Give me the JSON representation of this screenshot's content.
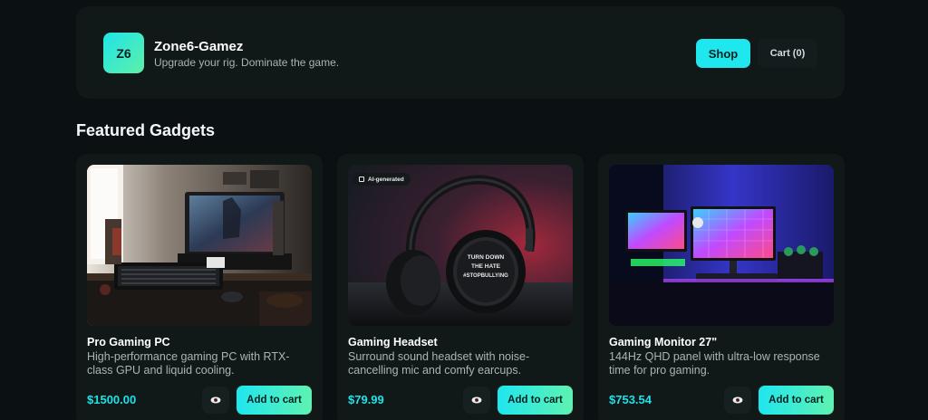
{
  "header": {
    "logo_text": "Z6",
    "brand_name": "Zone6-Gamez",
    "tagline": "Upgrade your rig. Dominate the game.",
    "shop_label": "Shop",
    "cart_label": "Cart (0)"
  },
  "section_title": "Featured Gadgets",
  "products": [
    {
      "title": "Pro Gaming PC",
      "description": "High-performance gaming PC with RTX-class GPU and liquid cooling.",
      "price": "$1500.00",
      "add_label": "Add to cart",
      "view_icon": "eye-icon"
    },
    {
      "title": "Gaming Headset",
      "description": "Surround sound headset with noise-cancelling mic and comfy earcups.",
      "price": "$79.99",
      "add_label": "Add to cart",
      "view_icon": "eye-icon",
      "badge": "AI-generated",
      "image_text": "TURN DOWN THE HATE #STOPBULLYING"
    },
    {
      "title": "Gaming Monitor 27\"",
      "description": "144Hz QHD panel with ultra-low response time for pro gaming.",
      "price": "$753.54",
      "add_label": "Add to cart",
      "view_icon": "eye-icon"
    }
  ],
  "colors": {
    "accent": "#1ee8ee",
    "accent_gradient_end": "#5ff2b1",
    "background": "#0b1112",
    "panel": "#111818"
  }
}
